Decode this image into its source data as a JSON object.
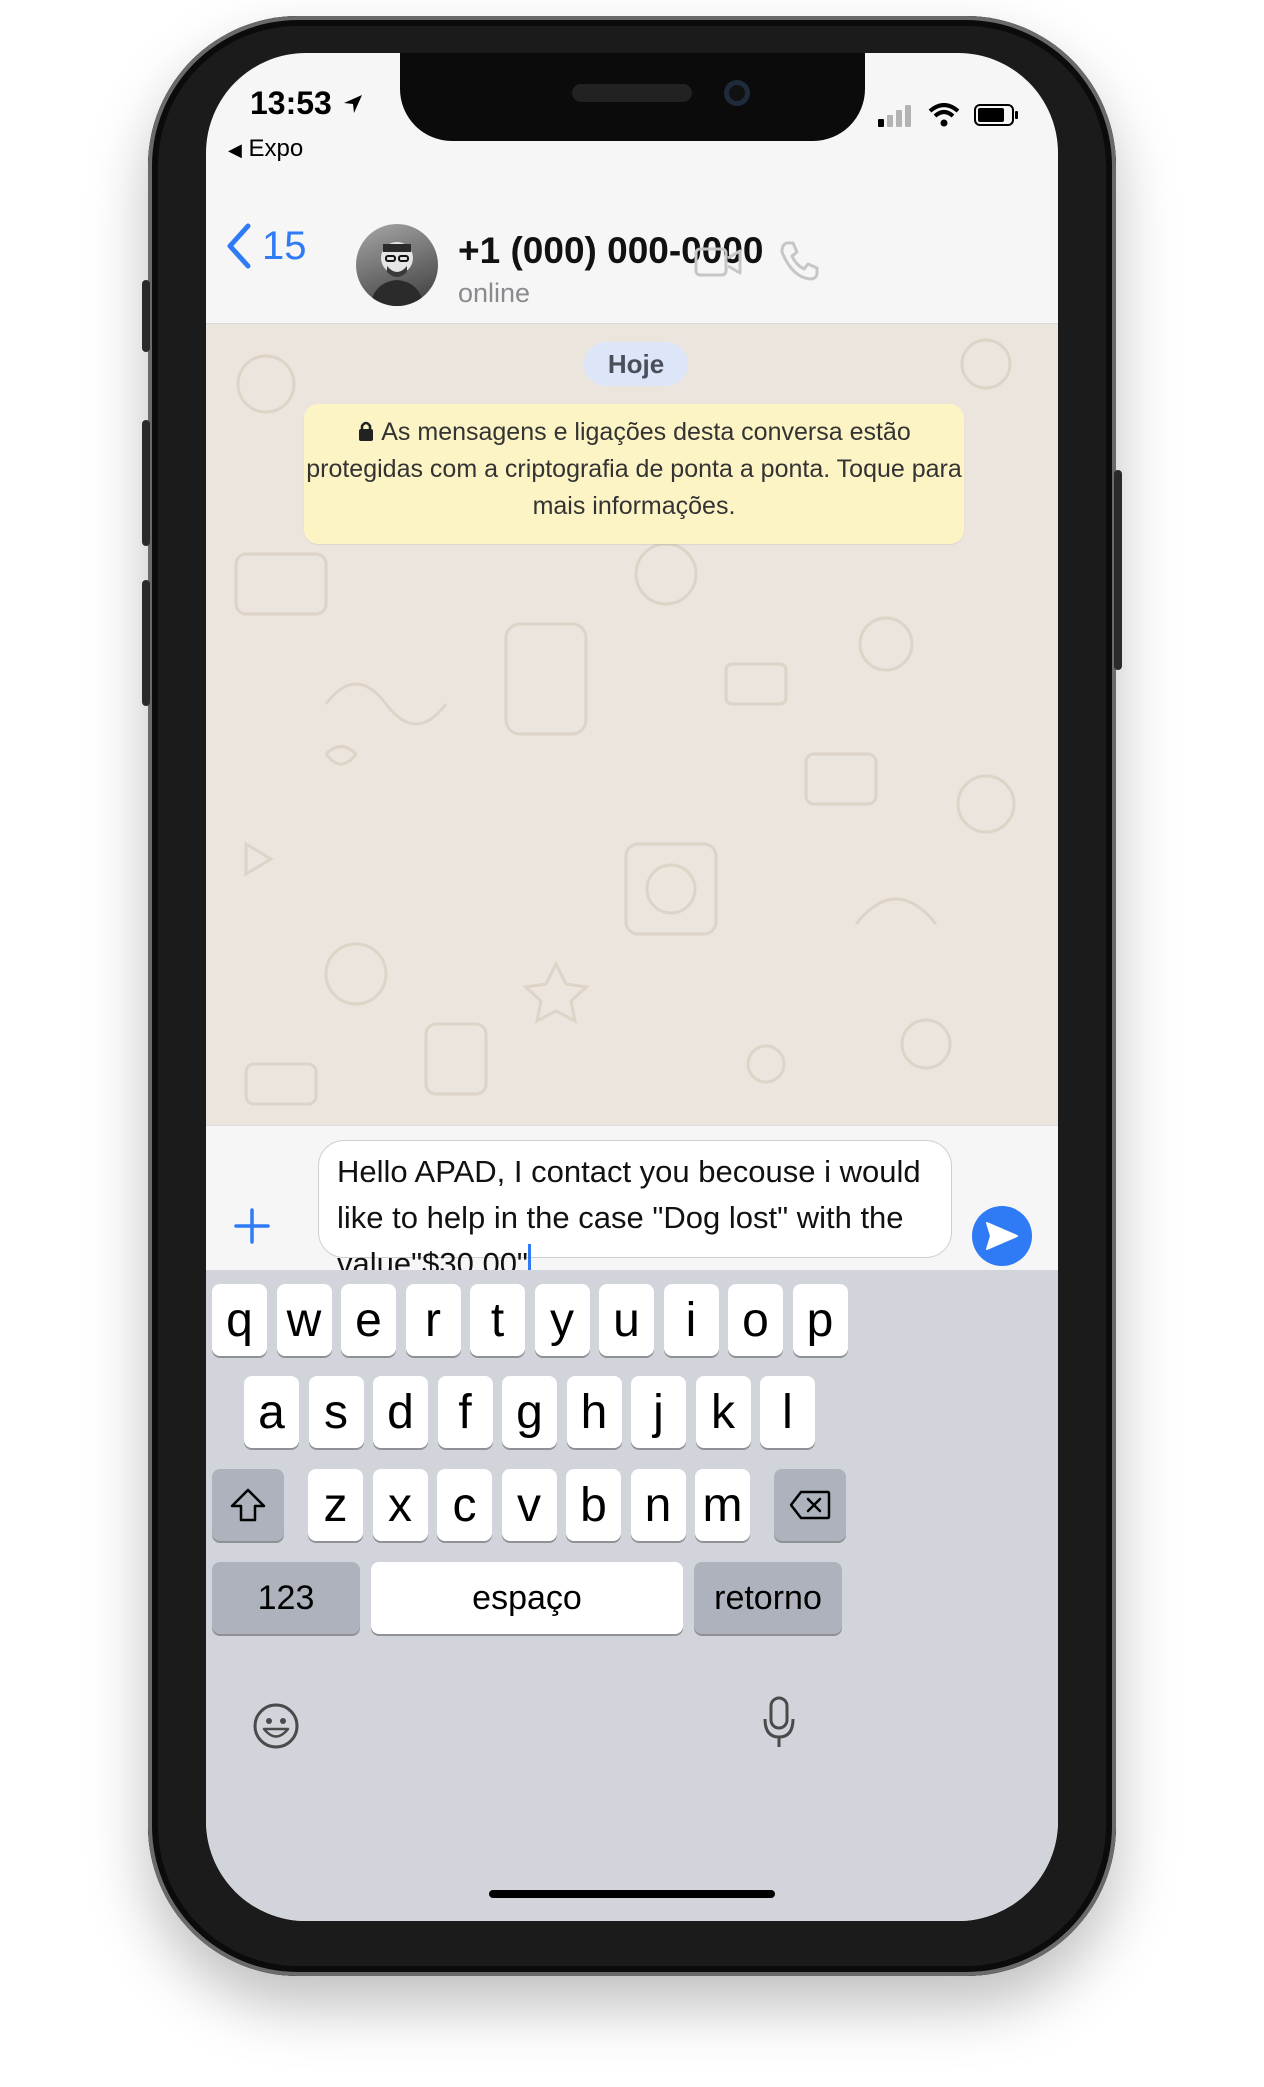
{
  "status_bar": {
    "time": "13:53",
    "back_app": "Expo"
  },
  "header": {
    "back_count": "15",
    "contact_name": "+1 (000) 000-0000",
    "contact_status": "online"
  },
  "chat": {
    "date_label": "Hoje",
    "system_message": "As mensagens e ligações desta conversa estão protegidas com a criptografia de ponta a ponta. Toque para mais informações.",
    "background_color": "#ece5dd"
  },
  "composer": {
    "text": "Hello APAD, I contact you becouse i would like to help in the case \"Dog lost\" with the value\"$30.00\""
  },
  "keyboard": {
    "row1": [
      "q",
      "w",
      "e",
      "r",
      "t",
      "y",
      "u",
      "i",
      "o",
      "p"
    ],
    "row2": [
      "a",
      "s",
      "d",
      "f",
      "g",
      "h",
      "j",
      "k",
      "l"
    ],
    "row3": [
      "z",
      "x",
      "c",
      "v",
      "b",
      "n",
      "m"
    ],
    "numbers_label": "123",
    "space_label": "espaço",
    "return_label": "retorno"
  },
  "colors": {
    "accent": "#2f7bf6",
    "system_msg_bg": "#fdf4c5",
    "date_pill_bg": "#dce6f8"
  }
}
